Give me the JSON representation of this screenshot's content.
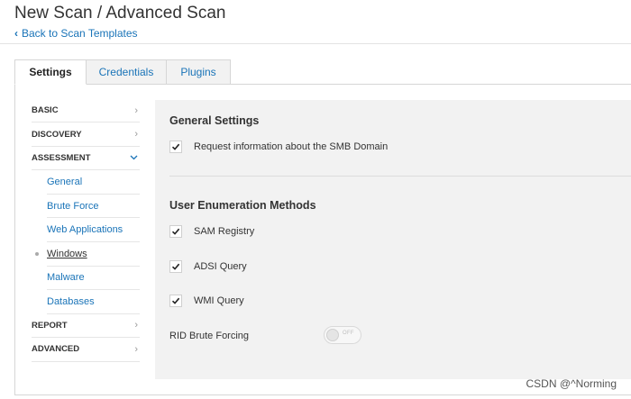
{
  "header": {
    "title": "New Scan / Advanced Scan",
    "back_label": "Back to Scan Templates"
  },
  "tabs": [
    {
      "label": "Settings",
      "active": true
    },
    {
      "label": "Credentials",
      "active": false
    },
    {
      "label": "Plugins",
      "active": false
    }
  ],
  "sidebar": {
    "basic": "BASIC",
    "discovery": "DISCOVERY",
    "assessment": "ASSESSMENT",
    "sub": {
      "general": "General",
      "brute_force": "Brute Force",
      "web_applications": "Web Applications",
      "windows": "Windows",
      "malware": "Malware",
      "databases": "Databases"
    },
    "current": "Windows",
    "report": "REPORT",
    "advanced": "ADVANCED"
  },
  "content": {
    "general_settings": {
      "title": "General Settings",
      "smb_domain": {
        "label": "Request information about the SMB Domain",
        "checked": true
      }
    },
    "user_enumeration": {
      "title": "User Enumeration Methods",
      "sam_registry": {
        "label": "SAM Registry",
        "checked": true
      },
      "adsi_query": {
        "label": "ADSI Query",
        "checked": true
      },
      "wmi_query": {
        "label": "WMI Query",
        "checked": true
      }
    },
    "rid_brute_forcing": {
      "label": "RID Brute Forcing",
      "toggle_text": "OFF",
      "on": false
    }
  },
  "watermark": "CSDN @^Norming",
  "colors": {
    "link": "#1a74b8",
    "panel_bg": "#f2f2f2",
    "border": "#d6d6d6"
  }
}
